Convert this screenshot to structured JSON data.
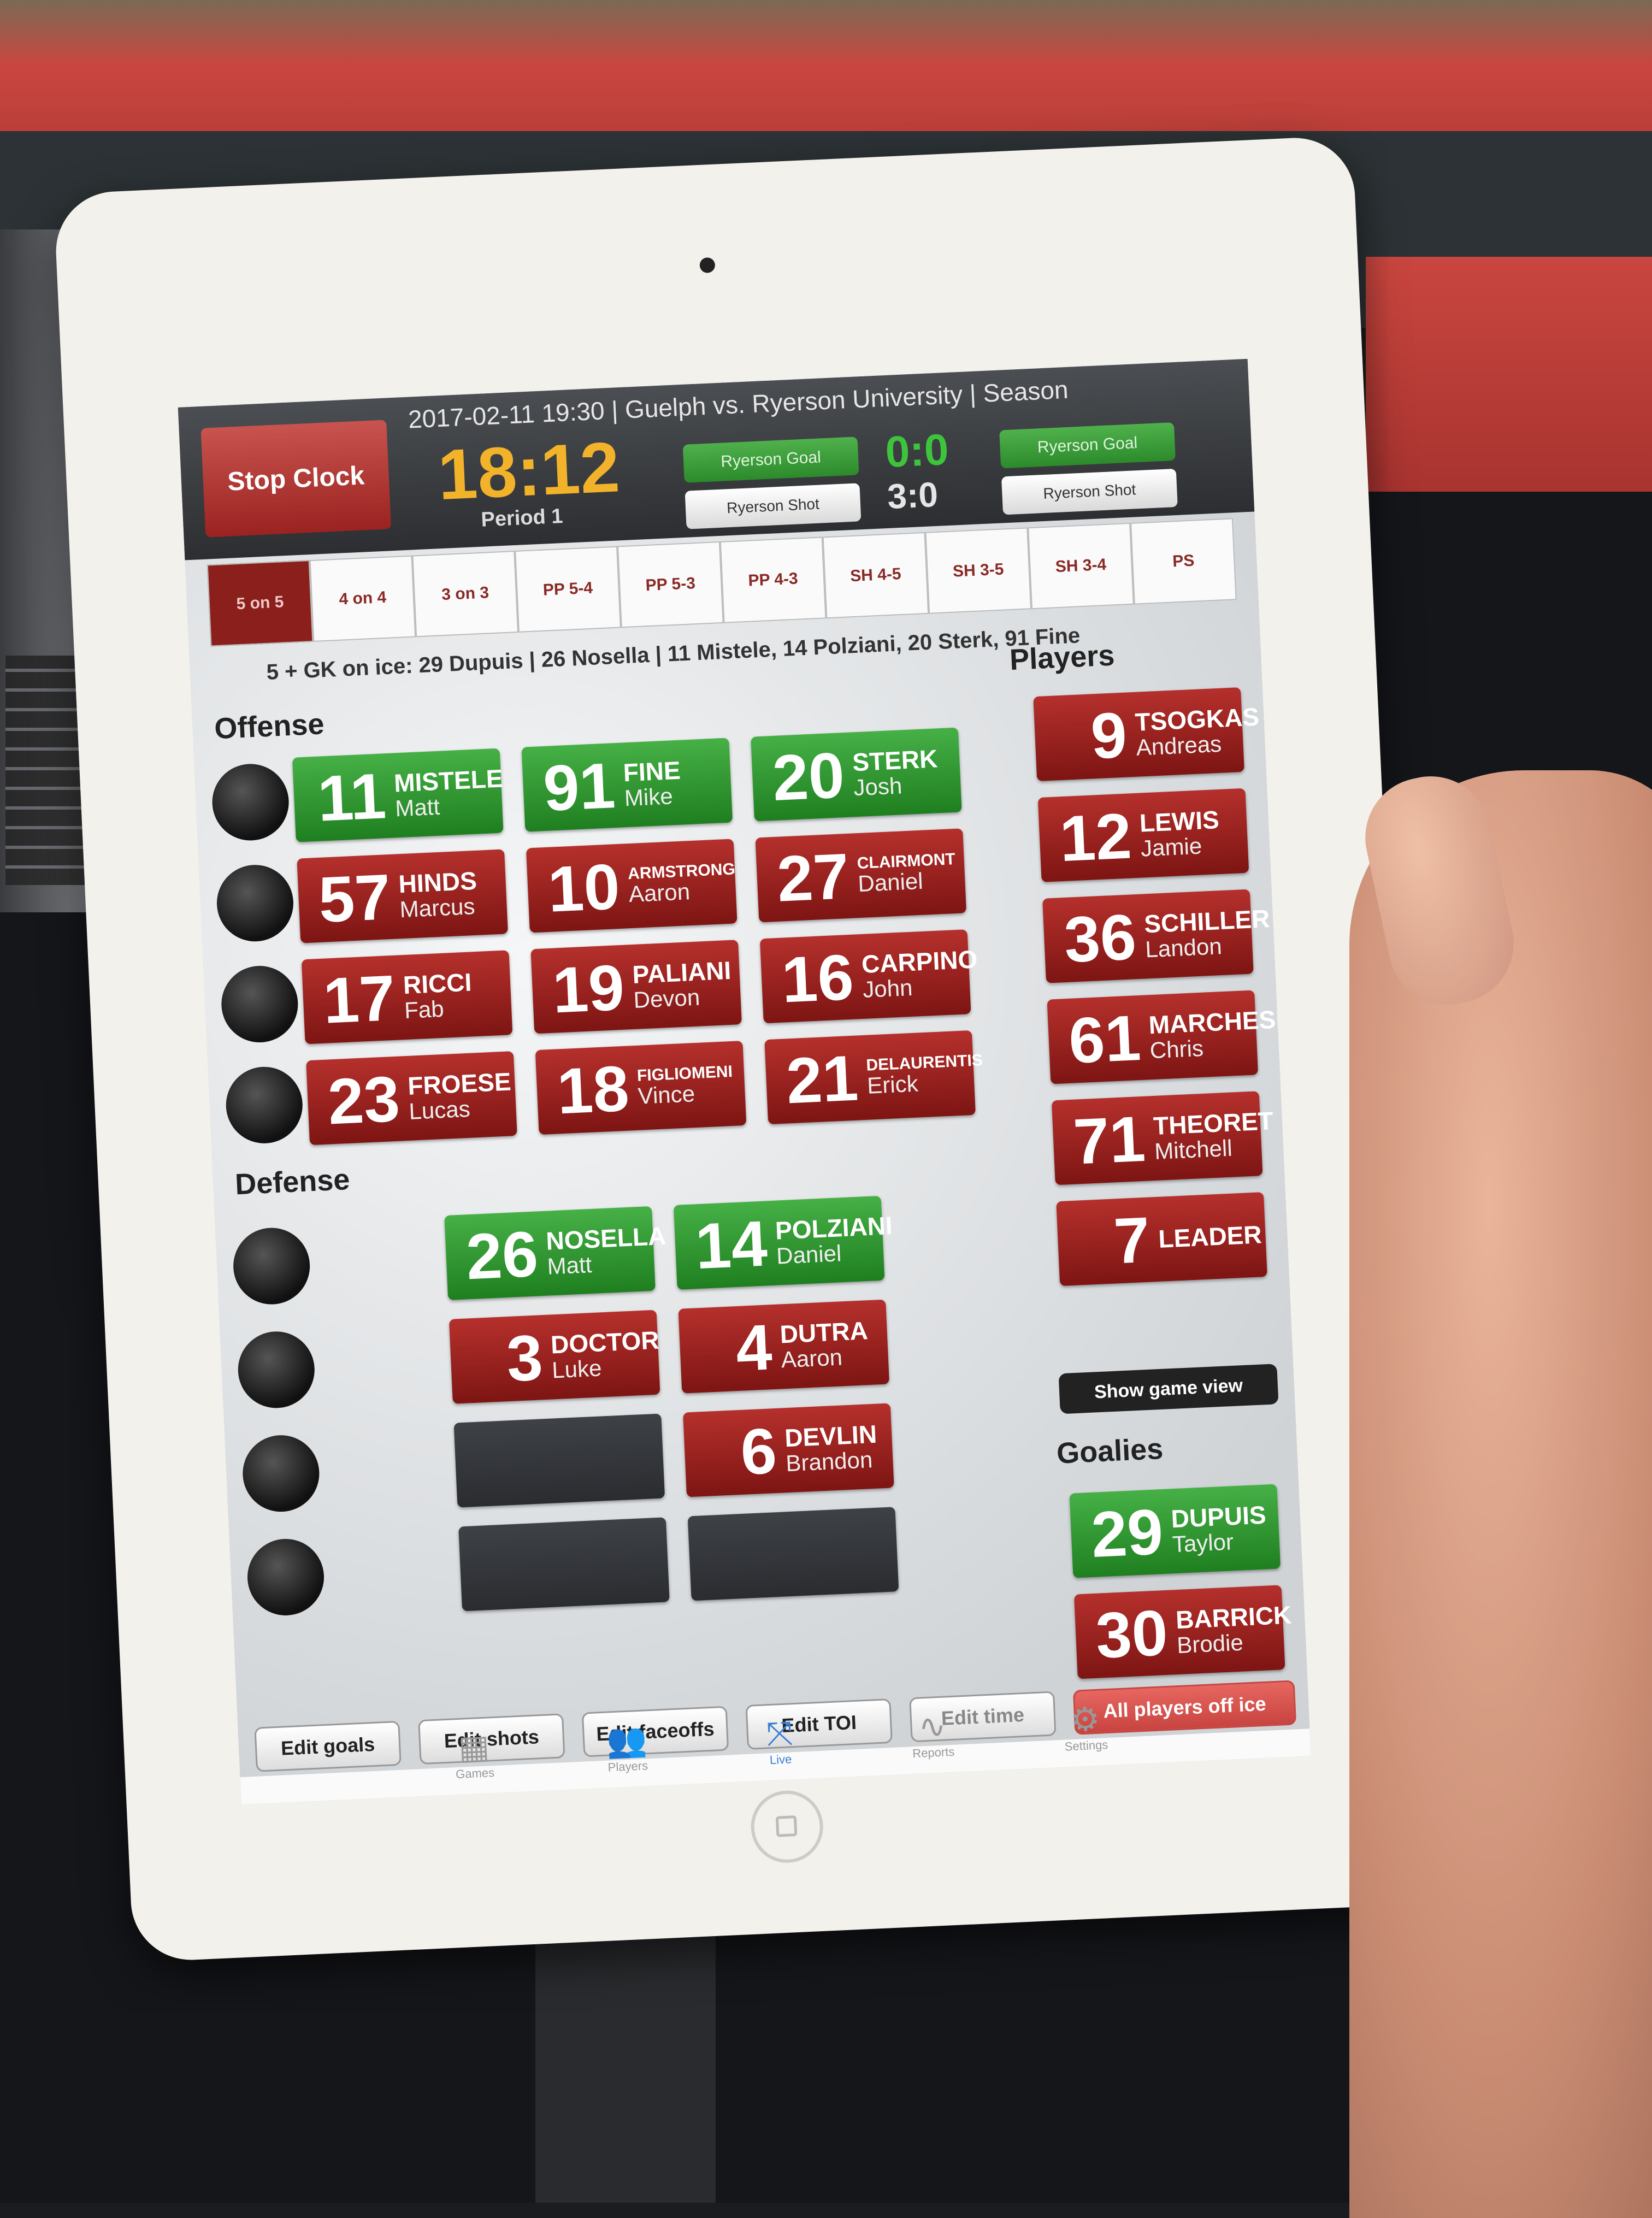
{
  "header": {
    "stop_button": "Stop Clock",
    "game_title": "2017-02-11 19:30 | Guelph vs. Ryerson University | Season",
    "clock": "18:12",
    "period": "Period 1",
    "goal_left": "Ryerson Goal",
    "shot_left": "Ryerson Shot",
    "goal_right": "Ryerson Goal",
    "shot_right": "Ryerson Shot",
    "score_goals": "0:0",
    "score_shots": "3:0"
  },
  "tabs": [
    "5 on 5",
    "4 on 4",
    "3 on 3",
    "PP 5-4",
    "PP 5-3",
    "PP 4-3",
    "SH 4-5",
    "SH 3-5",
    "SH 3-4",
    "PS"
  ],
  "on_ice": "5 + GK on ice: 29 Dupuis | 26 Nosella | 11 Mistele, 14 Polziani, 20 Sterk, 91 Fine",
  "labels": {
    "offense": "Offense",
    "defense": "Defense",
    "players": "Players",
    "goalies": "Goalies",
    "show_game_view": "Show game view"
  },
  "offense": [
    [
      {
        "num": "11",
        "last": "MISTELE",
        "first": "Matt",
        "state": "green"
      },
      {
        "num": "91",
        "last": "FINE",
        "first": "Mike",
        "state": "green"
      },
      {
        "num": "20",
        "last": "STERK",
        "first": "Josh",
        "state": "green"
      }
    ],
    [
      {
        "num": "57",
        "last": "HINDS",
        "first": "Marcus",
        "state": "red"
      },
      {
        "num": "10",
        "last": "ARMSTRONG",
        "first": "Aaron",
        "state": "red"
      },
      {
        "num": "27",
        "last": "CLAIRMONT",
        "first": "Daniel",
        "state": "red"
      }
    ],
    [
      {
        "num": "17",
        "last": "RICCI",
        "first": "Fab",
        "state": "red"
      },
      {
        "num": "19",
        "last": "PALIANI",
        "first": "Devon",
        "state": "red"
      },
      {
        "num": "16",
        "last": "CARPINO",
        "first": "John",
        "state": "red"
      }
    ],
    [
      {
        "num": "23",
        "last": "FROESE",
        "first": "Lucas",
        "state": "red"
      },
      {
        "num": "18",
        "last": "FIGLIOMENI",
        "first": "Vince",
        "state": "red"
      },
      {
        "num": "21",
        "last": "DELAURENTIS",
        "first": "Erick",
        "state": "red"
      }
    ]
  ],
  "defense": [
    [
      {
        "num": "26",
        "last": "NOSELLA",
        "first": "Matt",
        "state": "green"
      },
      {
        "num": "14",
        "last": "POLZIANI",
        "first": "Daniel",
        "state": "green"
      }
    ],
    [
      {
        "num": "3",
        "last": "DOCTOR",
        "first": "Luke",
        "state": "red"
      },
      {
        "num": "4",
        "last": "DUTRA",
        "first": "Aaron",
        "state": "red"
      }
    ],
    [
      {
        "num": "",
        "last": "",
        "first": "",
        "state": "empty"
      },
      {
        "num": "6",
        "last": "DEVLIN",
        "first": "Brandon",
        "state": "red"
      }
    ],
    [
      {
        "num": "",
        "last": "",
        "first": "",
        "state": "empty"
      },
      {
        "num": "",
        "last": "",
        "first": "",
        "state": "empty"
      }
    ]
  ],
  "players": [
    {
      "num": "9",
      "last": "TSOGKAS",
      "first": "Andreas",
      "state": "red"
    },
    {
      "num": "12",
      "last": "LEWIS",
      "first": "Jamie",
      "state": "red"
    },
    {
      "num": "36",
      "last": "SCHILLER",
      "first": "Landon",
      "state": "red"
    },
    {
      "num": "61",
      "last": "MARCHESE",
      "first": "Chris",
      "state": "red"
    },
    {
      "num": "71",
      "last": "THEORET",
      "first": "Mitchell",
      "state": "red"
    },
    {
      "num": "7",
      "last": "LEADER",
      "first": "",
      "state": "red"
    }
  ],
  "goalies": [
    {
      "num": "29",
      "last": "DUPUIS",
      "first": "Taylor",
      "state": "green"
    },
    {
      "num": "30",
      "last": "BARRICK",
      "first": "Brodie",
      "state": "red"
    }
  ],
  "bottom_buttons": {
    "edit_goals": "Edit goals",
    "edit_shots": "Edit shots",
    "edit_faceoffs": "Edit faceoffs",
    "edit_toi": "Edit TOI",
    "edit_time": "Edit time",
    "all_off": "All players off ice"
  },
  "tabbar": [
    {
      "label": "Games",
      "icon": "calendar-icon"
    },
    {
      "label": "Players",
      "icon": "people-icon"
    },
    {
      "label": "Live",
      "icon": "play-diagram-icon"
    },
    {
      "label": "Reports",
      "icon": "chart-line-icon"
    },
    {
      "label": "Settings",
      "icon": "gear-icon"
    }
  ],
  "colors": {
    "accent_red": "#8a1f1c",
    "on_ice_green": "#2c8a2b",
    "clock_orange": "#f2b32a",
    "live_blue": "#3b7fd6"
  }
}
